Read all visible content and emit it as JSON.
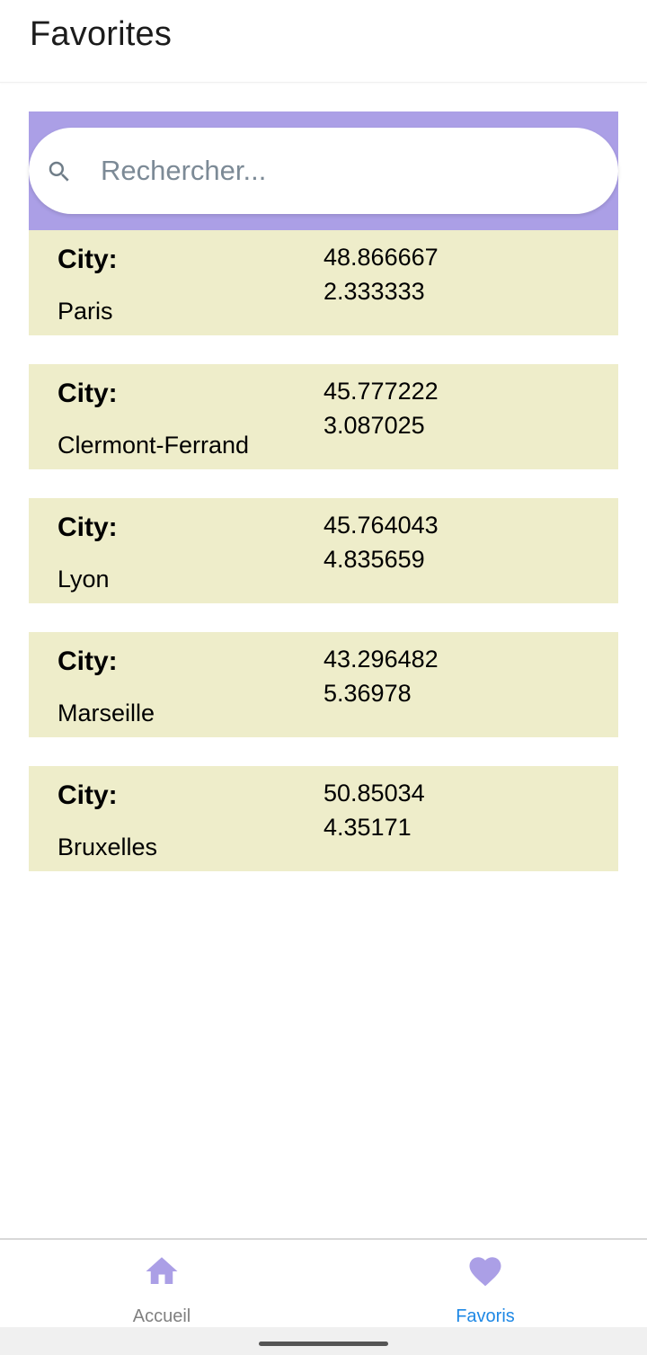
{
  "header": {
    "title": "Favorites"
  },
  "search": {
    "placeholder": "Rechercher...",
    "value": ""
  },
  "cities": [
    {
      "label": "City:",
      "name": "Paris",
      "lat": "48.866667",
      "lon": "2.333333"
    },
    {
      "label": "City:",
      "name": "Clermont-Ferrand",
      "lat": "45.777222",
      "lon": "3.087025"
    },
    {
      "label": "City:",
      "name": "Lyon",
      "lat": "45.764043",
      "lon": "4.835659"
    },
    {
      "label": "City:",
      "name": "Marseille",
      "lat": "43.296482",
      "lon": "5.36978"
    },
    {
      "label": "City:",
      "name": "Bruxelles",
      "lat": "50.85034",
      "lon": "4.35171"
    }
  ],
  "bottom_nav": {
    "items": [
      {
        "label": "Accueil",
        "icon": "home-icon",
        "active": false
      },
      {
        "label": "Favoris",
        "icon": "heart-icon",
        "active": true
      }
    ]
  },
  "colors": {
    "accent": "#ab9fe6",
    "card_background": "#eeedca",
    "active_nav_label": "#1e88e5",
    "inactive_nav_label": "#808080"
  }
}
